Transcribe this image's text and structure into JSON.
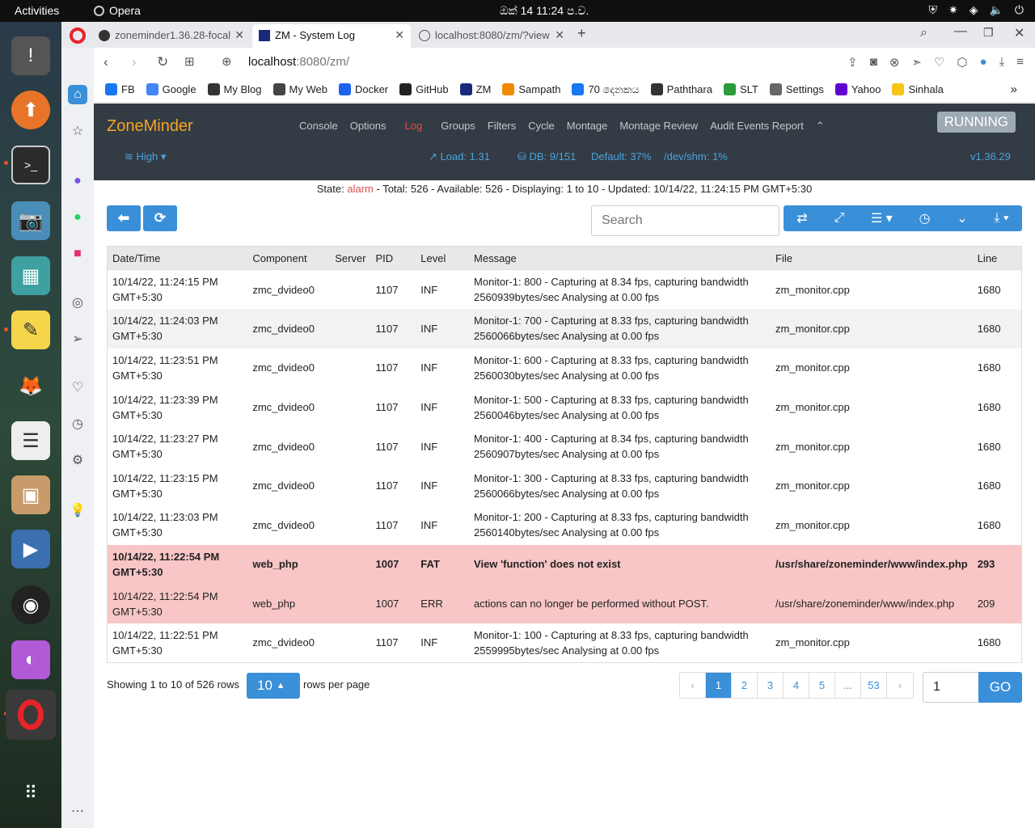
{
  "topbar": {
    "activities": "Activities",
    "app_name": "Opera",
    "clock": "ඔක් 14  11:24 ප.ව."
  },
  "browser": {
    "tabs": [
      {
        "label": "zoneminder1.36.28-focal"
      },
      {
        "label": "ZM - System Log"
      },
      {
        "label": "localhost:8080/zm/?view"
      }
    ],
    "url_host": "localhost",
    "url_rest": ":8080/zm/",
    "bookmarks": [
      {
        "label": "FB",
        "color": "#1877f2"
      },
      {
        "label": "Google",
        "color": "#4285f4"
      },
      {
        "label": "My Blog",
        "color": "#333333"
      },
      {
        "label": "My Web",
        "color": "#444444"
      },
      {
        "label": "Docker",
        "color": "#1d63ed"
      },
      {
        "label": "GitHub",
        "color": "#222222"
      },
      {
        "label": "ZM",
        "color": "#1a2a7a"
      },
      {
        "label": "Sampath",
        "color": "#f08a00"
      },
      {
        "label": "70 දෙනකය",
        "color": "#1877f2"
      },
      {
        "label": "Paththara",
        "color": "#333333"
      },
      {
        "label": "SLT",
        "color": "#2c9b3a"
      },
      {
        "label": "Settings",
        "color": "#666666"
      },
      {
        "label": "Yahoo",
        "color": "#6001d2"
      },
      {
        "label": "Sinhala",
        "color": "#f5c518"
      }
    ]
  },
  "zm": {
    "brand": "ZoneMinder",
    "menu": [
      "Console",
      "Options",
      "Log",
      "Groups",
      "Filters",
      "Cycle",
      "Montage",
      "Montage Review",
      "Audit Events Report"
    ],
    "running": "RUNNING",
    "bandwidth": "High",
    "load": "Load: 1.31",
    "db": "DB: 9/151",
    "default": "Default: 37%",
    "shm": "/dev/shm: 1%",
    "version": "v1.36.29"
  },
  "state": {
    "label": "State:",
    "value": "alarm",
    "rest": "-  Total: 526 -  Available: 526 -  Displaying: 1 to 10 -  Updated: 10/14/22, 11:24:15 PM GMT+5:30"
  },
  "search": {
    "placeholder": "Search"
  },
  "table": {
    "headers": [
      "Date/Time",
      "Component",
      "Server",
      "PID",
      "Level",
      "Message",
      "File",
      "Line"
    ],
    "rows": [
      {
        "dt": "10/14/22, 11:24:15 PM GMT+5:30",
        "comp": "zmc_dvideo0",
        "server": "",
        "pid": "1107",
        "level": "INF",
        "msg": "Monitor-1: 800 - Capturing at 8.34 fps, capturing bandwidth 2560939bytes/sec Analysing at 0.00 fps",
        "file": "zm_monitor.cpp",
        "line": "1680",
        "type": "odd"
      },
      {
        "dt": "10/14/22, 11:24:03 PM GMT+5:30",
        "comp": "zmc_dvideo0",
        "server": "",
        "pid": "1107",
        "level": "INF",
        "msg": "Monitor-1: 700 - Capturing at 8.33 fps, capturing bandwidth 2560066bytes/sec Analysing at 0.00 fps",
        "file": "zm_monitor.cpp",
        "line": "1680",
        "type": "even"
      },
      {
        "dt": "10/14/22, 11:23:51 PM GMT+5:30",
        "comp": "zmc_dvideo0",
        "server": "",
        "pid": "1107",
        "level": "INF",
        "msg": "Monitor-1: 600 - Capturing at 8.33 fps, capturing bandwidth 2560030bytes/sec Analysing at 0.00 fps",
        "file": "zm_monitor.cpp",
        "line": "1680",
        "type": "odd"
      },
      {
        "dt": "10/14/22, 11:23:39 PM GMT+5:30",
        "comp": "zmc_dvideo0",
        "server": "",
        "pid": "1107",
        "level": "INF",
        "msg": "Monitor-1: 500 - Capturing at 8.33 fps, capturing bandwidth 2560046bytes/sec Analysing at 0.00 fps",
        "file": "zm_monitor.cpp",
        "line": "1680",
        "type": "odd"
      },
      {
        "dt": "10/14/22, 11:23:27 PM GMT+5:30",
        "comp": "zmc_dvideo0",
        "server": "",
        "pid": "1107",
        "level": "INF",
        "msg": "Monitor-1: 400 - Capturing at 8.34 fps, capturing bandwidth 2560907bytes/sec Analysing at 0.00 fps",
        "file": "zm_monitor.cpp",
        "line": "1680",
        "type": "odd"
      },
      {
        "dt": "10/14/22, 11:23:15 PM GMT+5:30",
        "comp": "zmc_dvideo0",
        "server": "",
        "pid": "1107",
        "level": "INF",
        "msg": "Monitor-1: 300 - Capturing at 8.33 fps, capturing bandwidth 2560066bytes/sec Analysing at 0.00 fps",
        "file": "zm_monitor.cpp",
        "line": "1680",
        "type": "odd"
      },
      {
        "dt": "10/14/22, 11:23:03 PM GMT+5:30",
        "comp": "zmc_dvideo0",
        "server": "",
        "pid": "1107",
        "level": "INF",
        "msg": "Monitor-1: 200 - Capturing at 8.33 fps, capturing bandwidth 2560140bytes/sec Analysing at 0.00 fps",
        "file": "zm_monitor.cpp",
        "line": "1680",
        "type": "odd"
      },
      {
        "dt": "10/14/22, 11:22:54 PM GMT+5:30",
        "comp": "web_php",
        "server": "",
        "pid": "1007",
        "level": "FAT",
        "msg": "View 'function' does not exist",
        "file": "/usr/share/zoneminder/www/index.php",
        "line": "293",
        "type": "fat"
      },
      {
        "dt": "10/14/22, 11:22:54 PM GMT+5:30",
        "comp": "web_php",
        "server": "",
        "pid": "1007",
        "level": "ERR",
        "msg": "actions can no longer be performed without POST.",
        "file": "/usr/share/zoneminder/www/index.php",
        "line": "209",
        "type": "err"
      },
      {
        "dt": "10/14/22, 11:22:51 PM GMT+5:30",
        "comp": "zmc_dvideo0",
        "server": "",
        "pid": "1107",
        "level": "INF",
        "msg": "Monitor-1: 100 - Capturing at 8.33 fps, capturing bandwidth 2559995bytes/sec Analysing at 0.00 fps",
        "file": "zm_monitor.cpp",
        "line": "1680",
        "type": "odd"
      }
    ]
  },
  "footer": {
    "showing": "Showing 1 to 10 of 526 rows",
    "per_page": "10",
    "rows_per_page": "rows per page",
    "pages": [
      "‹",
      "1",
      "2",
      "3",
      "4",
      "5",
      "...",
      "53",
      "›"
    ],
    "current_page": "1",
    "go_value": "1",
    "go_label": "GO"
  }
}
